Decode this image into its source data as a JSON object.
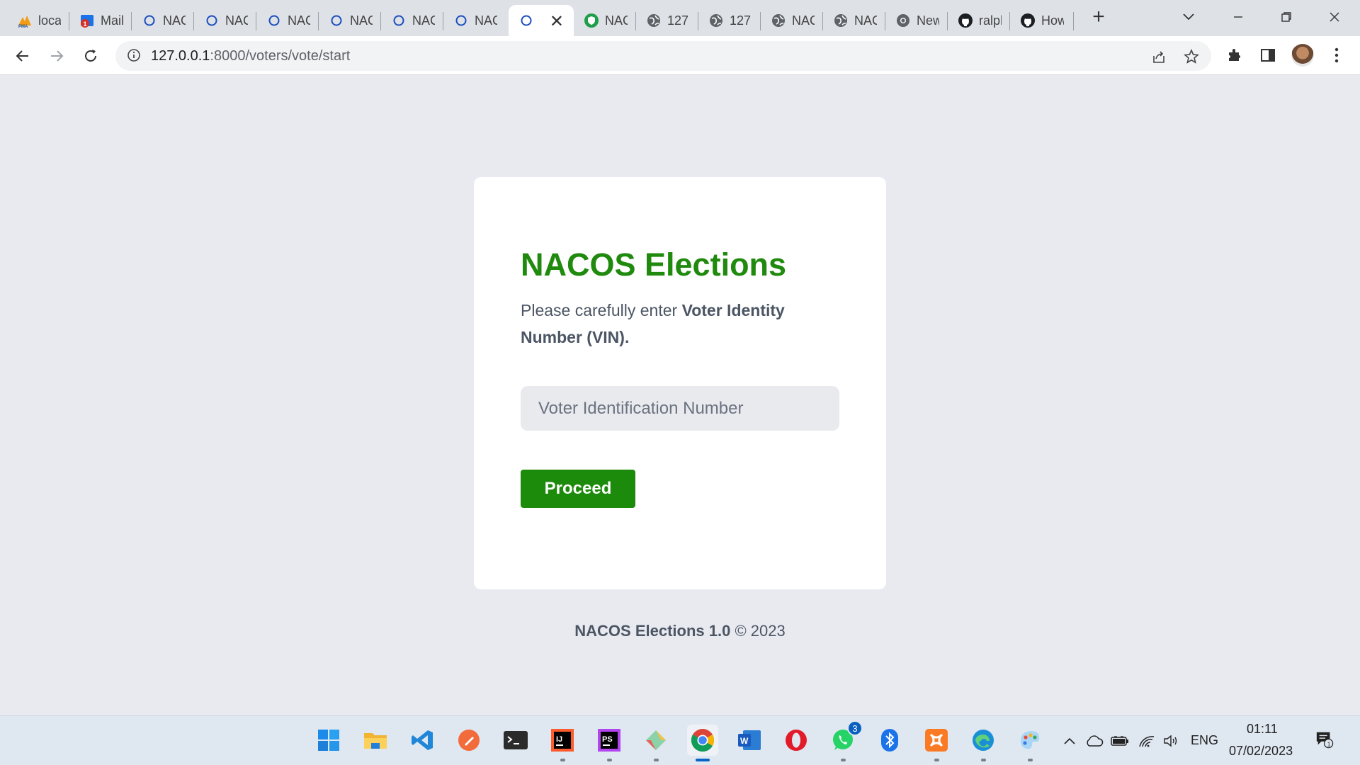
{
  "browser": {
    "tabs": [
      {
        "title": "localhost",
        "icon": "phpmyadmin-icon"
      },
      {
        "title": "Mail",
        "icon": "mail-icon"
      },
      {
        "title": "NACOS",
        "icon": "loading-circle-icon"
      },
      {
        "title": "NACOS",
        "icon": "loading-circle-icon"
      },
      {
        "title": "NACOS",
        "icon": "loading-circle-icon"
      },
      {
        "title": "NACOS",
        "icon": "loading-circle-icon"
      },
      {
        "title": "NACOS",
        "icon": "loading-circle-icon"
      },
      {
        "title": "NACOS",
        "icon": "loading-circle-icon"
      },
      {
        "title": "",
        "icon": "loading-circle-icon",
        "active": true
      },
      {
        "title": "NACOS",
        "icon": "shield-icon"
      },
      {
        "title": "127",
        "icon": "globe-icon"
      },
      {
        "title": "127",
        "icon": "globe-icon"
      },
      {
        "title": "NACOS",
        "icon": "globe-icon"
      },
      {
        "title": "NACOS",
        "icon": "globe-icon"
      },
      {
        "title": "New",
        "icon": "chrome-icon"
      },
      {
        "title": "ralph",
        "icon": "github-icon"
      },
      {
        "title": "How",
        "icon": "github-icon"
      }
    ],
    "address": {
      "host": "127.0.0.1",
      "path": ":8000/voters/vote/start"
    }
  },
  "page": {
    "title": "NACOS Elections",
    "lead_prefix": "Please carefully enter ",
    "lead_bold": "Voter Identity Number (VIN).",
    "vin_placeholder": "Voter Identification Number",
    "proceed_label": "Proceed",
    "footer_name": "NACOS Elections 1.0",
    "footer_copy": " © 2023"
  },
  "taskbar": {
    "apps": [
      "windows-start-icon",
      "file-explorer-icon",
      "vscode-icon",
      "postman-icon",
      "terminal-icon",
      "intellij-icon",
      "phpstorm-icon",
      "git-icon",
      "chrome-icon",
      "word-icon",
      "opera-icon",
      "whatsapp-icon",
      "bluetooth-icon",
      "xampp-icon",
      "edge-icon",
      "paint-icon"
    ],
    "whatsapp_badge": "3",
    "language": "ENG",
    "time": "01:11",
    "date": "07/02/2023",
    "notification_count": "1"
  },
  "colors": {
    "accent_green": "#1f8a0d",
    "button_green": "#1c8a0a",
    "page_bg": "#e8eaf0"
  }
}
